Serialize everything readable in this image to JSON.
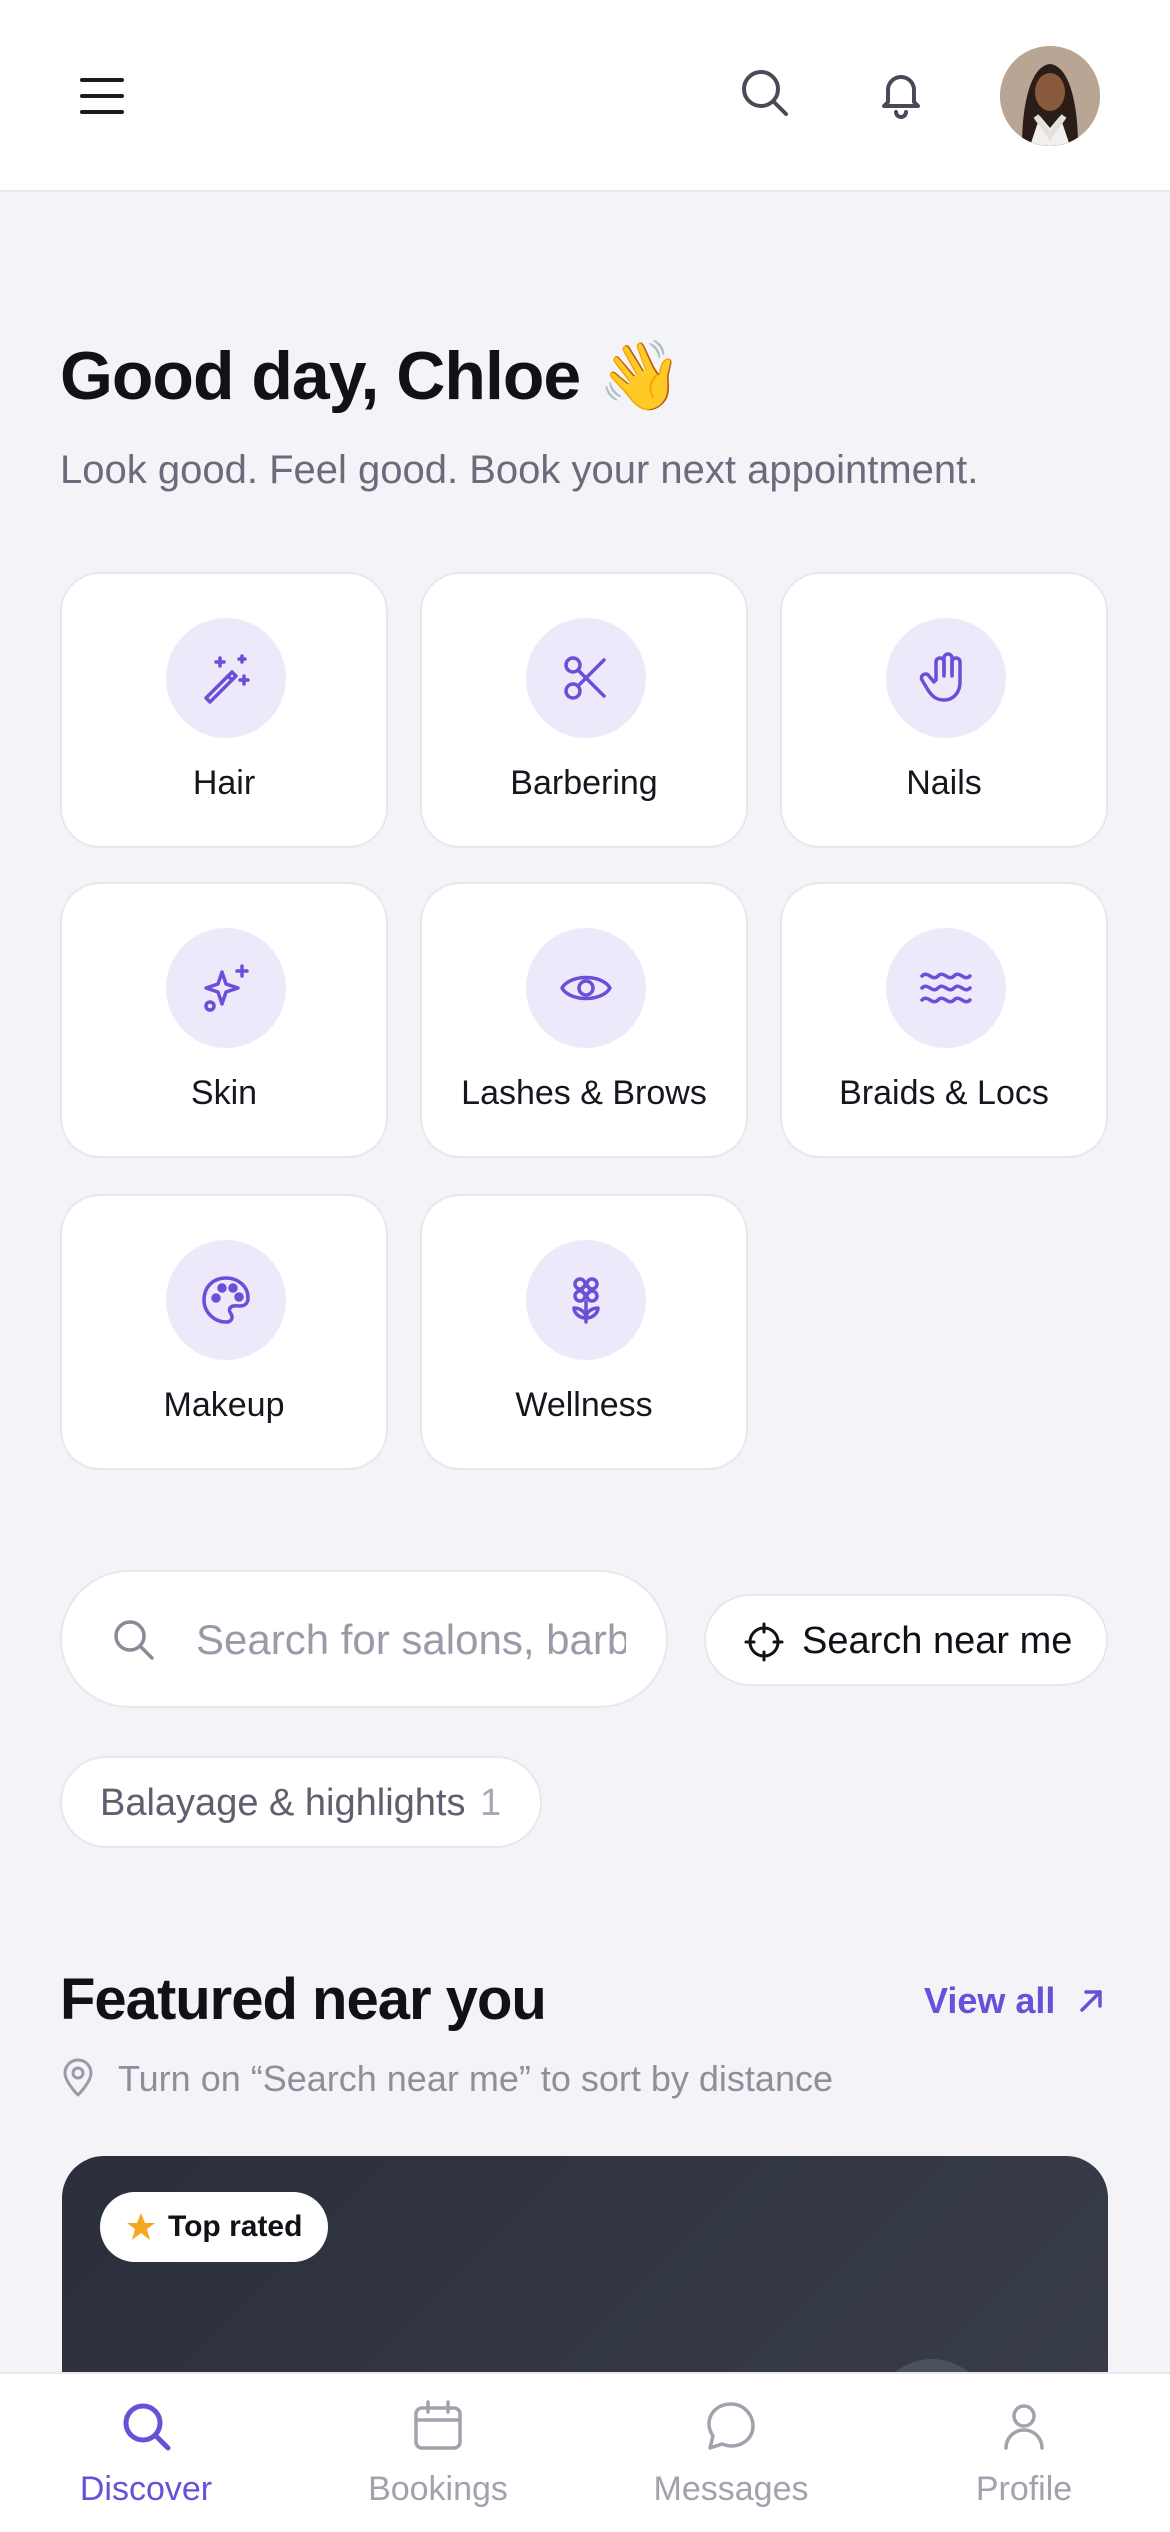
{
  "header": {
    "menu_icon": "menu-icon",
    "search_icon": "search-icon",
    "bell_icon": "bell-icon",
    "avatar_icon": "avatar"
  },
  "greeting": {
    "title": "Good day, Chloe 👋",
    "subtitle": "Look good. Feel good. Book your next appointment."
  },
  "categories": [
    {
      "label": "Hair",
      "icon": "magic-wand-icon"
    },
    {
      "label": "Barbering",
      "icon": "scissors-icon"
    },
    {
      "label": "Nails",
      "icon": "hand-icon"
    },
    {
      "label": "Skin",
      "icon": "sparkles-icon"
    },
    {
      "label": "Lashes & Brows",
      "icon": "eye-icon"
    },
    {
      "label": "Braids & Locs",
      "icon": "waves-icon"
    },
    {
      "label": "Makeup",
      "icon": "palette-icon"
    },
    {
      "label": "Wellness",
      "icon": "flower-icon"
    }
  ],
  "search": {
    "placeholder": "Search for salons, barbers, services",
    "near_me_label": "Search near me"
  },
  "chip": {
    "label": "Balayage & highlights",
    "count": "1"
  },
  "featured": {
    "title": "Featured near you",
    "view_all": "View all",
    "hint": "Turn on “Search near me” to sort by distance",
    "badge": "Top rated"
  },
  "nav": [
    {
      "label": "Discover",
      "icon": "discover-search-icon",
      "active": true
    },
    {
      "label": "Bookings",
      "icon": "calendar-icon",
      "active": false
    },
    {
      "label": "Messages",
      "icon": "chat-icon",
      "active": false
    },
    {
      "label": "Profile",
      "icon": "person-icon",
      "active": false
    }
  ],
  "colors": {
    "accent": "#6a4fd8",
    "accent_soft": "#ede9fb",
    "background": "#f4f3f8",
    "card_dark": "#2b2f3b",
    "star": "#f5a623"
  }
}
